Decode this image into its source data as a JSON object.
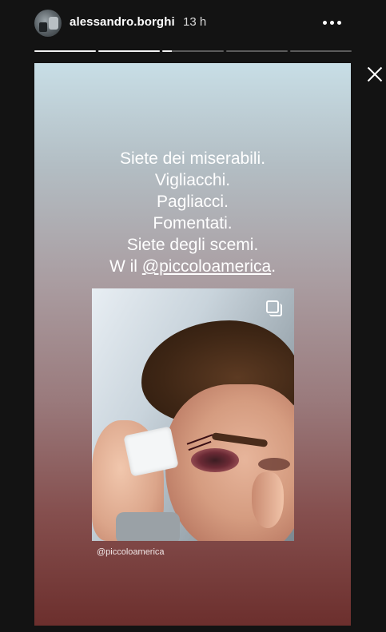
{
  "header": {
    "username": "alessandro.borghi",
    "time": "13 h"
  },
  "progress": {
    "segments": 5,
    "active_index": 2,
    "active_fraction": 0.15
  },
  "story": {
    "lines": [
      "Siete dei miserabili.",
      "Vigliacchi.",
      "Pagliacci.",
      "Fomentati.",
      "Siete degli scemi."
    ],
    "last_line_prefix": "W il ",
    "last_line_mention": "@piccoloamerica",
    "last_line_suffix": ".",
    "photo_caption": "@piccoloamerica"
  },
  "icons": {
    "more": "more-options-icon",
    "close": "close-icon",
    "multi": "multi-photo-icon"
  }
}
